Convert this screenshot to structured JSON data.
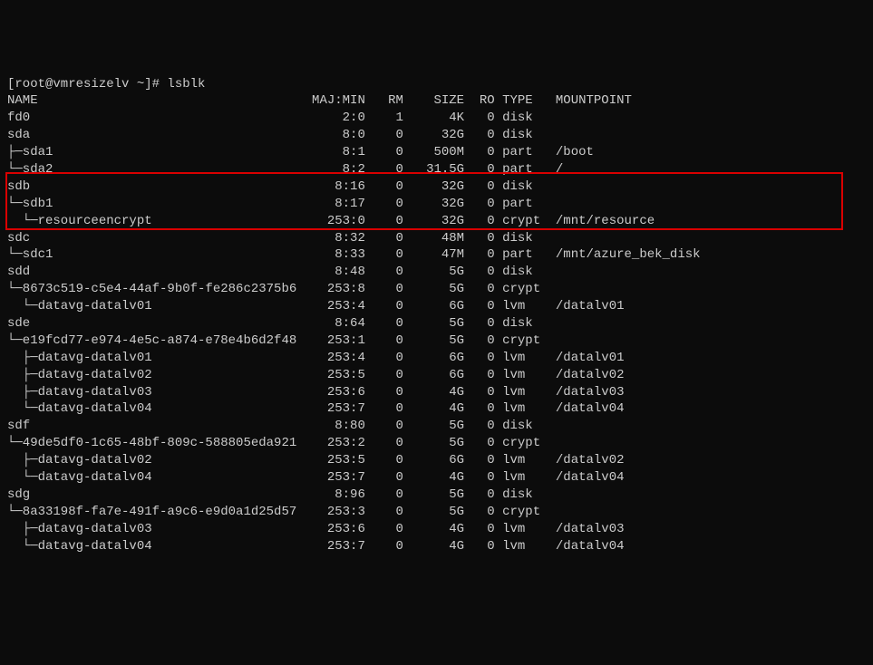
{
  "prompt": "[root@vmresizelv ~]#",
  "command": "lsblk",
  "header": {
    "name": "NAME",
    "majmin": "MAJ:MIN",
    "rm": "RM",
    "size": "SIZE",
    "ro": "RO",
    "type": "TYPE",
    "mount": "MOUNTPOINT"
  },
  "rows": [
    {
      "name": "fd0",
      "maj": "2:0",
      "rm": "1",
      "size": "4K",
      "ro": "0",
      "type": "disk",
      "mount": ""
    },
    {
      "name": "sda",
      "maj": "8:0",
      "rm": "0",
      "size": "32G",
      "ro": "0",
      "type": "disk",
      "mount": ""
    },
    {
      "name": "├─sda1",
      "maj": "8:1",
      "rm": "0",
      "size": "500M",
      "ro": "0",
      "type": "part",
      "mount": "/boot"
    },
    {
      "name": "└─sda2",
      "maj": "8:2",
      "rm": "0",
      "size": "31.5G",
      "ro": "0",
      "type": "part",
      "mount": "/"
    },
    {
      "name": "sdb",
      "maj": "8:16",
      "rm": "0",
      "size": "32G",
      "ro": "0",
      "type": "disk",
      "mount": ""
    },
    {
      "name": "└─sdb1",
      "maj": "8:17",
      "rm": "0",
      "size": "32G",
      "ro": "0",
      "type": "part",
      "mount": ""
    },
    {
      "name": "  └─resourceencrypt",
      "maj": "253:0",
      "rm": "0",
      "size": "32G",
      "ro": "0",
      "type": "crypt",
      "mount": "/mnt/resource"
    },
    {
      "name": "sdc",
      "maj": "8:32",
      "rm": "0",
      "size": "48M",
      "ro": "0",
      "type": "disk",
      "mount": ""
    },
    {
      "name": "└─sdc1",
      "maj": "8:33",
      "rm": "0",
      "size": "47M",
      "ro": "0",
      "type": "part",
      "mount": "/mnt/azure_bek_disk"
    },
    {
      "name": "sdd",
      "maj": "8:48",
      "rm": "0",
      "size": "5G",
      "ro": "0",
      "type": "disk",
      "mount": ""
    },
    {
      "name": "└─8673c519-c5e4-44af-9b0f-fe286c2375b6",
      "maj": "253:8",
      "rm": "0",
      "size": "5G",
      "ro": "0",
      "type": "crypt",
      "mount": ""
    },
    {
      "name": "  └─datavg-datalv01",
      "maj": "253:4",
      "rm": "0",
      "size": "6G",
      "ro": "0",
      "type": "lvm",
      "mount": "/datalv01"
    },
    {
      "name": "sde",
      "maj": "8:64",
      "rm": "0",
      "size": "5G",
      "ro": "0",
      "type": "disk",
      "mount": ""
    },
    {
      "name": "└─e19fcd77-e974-4e5c-a874-e78e4b6d2f48",
      "maj": "253:1",
      "rm": "0",
      "size": "5G",
      "ro": "0",
      "type": "crypt",
      "mount": ""
    },
    {
      "name": "  ├─datavg-datalv01",
      "maj": "253:4",
      "rm": "0",
      "size": "6G",
      "ro": "0",
      "type": "lvm",
      "mount": "/datalv01"
    },
    {
      "name": "  ├─datavg-datalv02",
      "maj": "253:5",
      "rm": "0",
      "size": "6G",
      "ro": "0",
      "type": "lvm",
      "mount": "/datalv02"
    },
    {
      "name": "  ├─datavg-datalv03",
      "maj": "253:6",
      "rm": "0",
      "size": "4G",
      "ro": "0",
      "type": "lvm",
      "mount": "/datalv03"
    },
    {
      "name": "  └─datavg-datalv04",
      "maj": "253:7",
      "rm": "0",
      "size": "4G",
      "ro": "0",
      "type": "lvm",
      "mount": "/datalv04"
    },
    {
      "name": "sdf",
      "maj": "8:80",
      "rm": "0",
      "size": "5G",
      "ro": "0",
      "type": "disk",
      "mount": ""
    },
    {
      "name": "└─49de5df0-1c65-48bf-809c-588805eda921",
      "maj": "253:2",
      "rm": "0",
      "size": "5G",
      "ro": "0",
      "type": "crypt",
      "mount": ""
    },
    {
      "name": "  ├─datavg-datalv02",
      "maj": "253:5",
      "rm": "0",
      "size": "6G",
      "ro": "0",
      "type": "lvm",
      "mount": "/datalv02"
    },
    {
      "name": "  └─datavg-datalv04",
      "maj": "253:7",
      "rm": "0",
      "size": "4G",
      "ro": "0",
      "type": "lvm",
      "mount": "/datalv04"
    },
    {
      "name": "sdg",
      "maj": "8:96",
      "rm": "0",
      "size": "5G",
      "ro": "0",
      "type": "disk",
      "mount": ""
    },
    {
      "name": "└─8a33198f-fa7e-491f-a9c6-e9d0a1d25d57",
      "maj": "253:3",
      "rm": "0",
      "size": "5G",
      "ro": "0",
      "type": "crypt",
      "mount": ""
    },
    {
      "name": "  ├─datavg-datalv03",
      "maj": "253:6",
      "rm": "0",
      "size": "4G",
      "ro": "0",
      "type": "lvm",
      "mount": "/datalv03"
    },
    {
      "name": "  └─datavg-datalv04",
      "maj": "253:7",
      "rm": "0",
      "size": "4G",
      "ro": "0",
      "type": "lvm",
      "mount": "/datalv04"
    }
  ],
  "widths": {
    "name": 40,
    "maj": 7,
    "rm": 4,
    "size": 7,
    "ro": 3,
    "type": 6
  }
}
